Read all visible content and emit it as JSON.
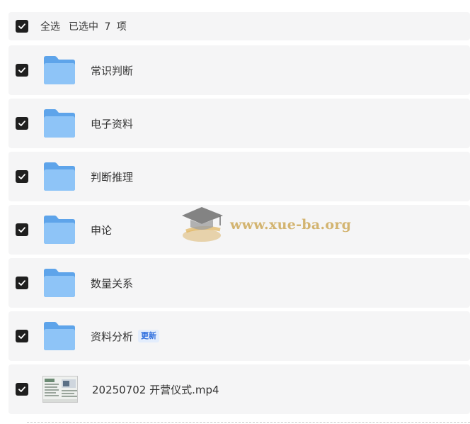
{
  "select_bar": {
    "label": "全选",
    "count_text": "已选中 7 项",
    "checked": true
  },
  "items": [
    {
      "name": "常识判断",
      "type": "folder",
      "checked": true
    },
    {
      "name": "电子资料",
      "type": "folder",
      "checked": true
    },
    {
      "name": "判断推理",
      "type": "folder",
      "checked": true
    },
    {
      "name": "申论",
      "type": "folder",
      "checked": true
    },
    {
      "name": "数量关系",
      "type": "folder",
      "checked": true
    },
    {
      "name": "资料分析",
      "type": "folder",
      "checked": true,
      "badge": "更新"
    },
    {
      "name": "20250702 开营仪式.mp4",
      "type": "video",
      "checked": true
    }
  ],
  "watermark": {
    "text": "www.xue-ba.org",
    "icon": "graduation-cap-icon"
  },
  "colors": {
    "row_bg": "#f5f5f6",
    "checkbox": "#1f1f1f",
    "folder_front": "#8ec4f7",
    "folder_back": "#5ea4ea",
    "badge_bg": "#e3edfc",
    "badge_text": "#2f6fde",
    "watermark": "#c9a24a"
  }
}
